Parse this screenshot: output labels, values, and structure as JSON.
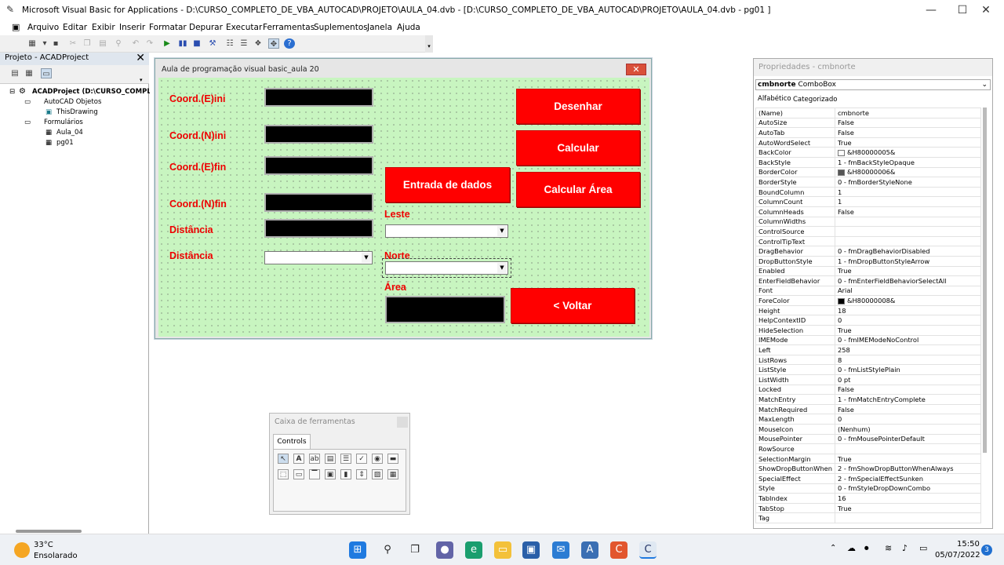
{
  "window": {
    "title": "Microsoft Visual Basic for Applications - D:\\CURSO_COMPLETO_DE_VBA_AUTOCAD\\PROJETO\\AULA_04.dvb - [D:\\CURSO_COMPLETO_DE_VBA_AUTOCAD\\PROJETO\\AULA_04.dvb - pg01 ]",
    "minimize": "—",
    "maximize": "☐",
    "close": "✕"
  },
  "menu": [
    "Arquivo",
    "Editar",
    "Exibir",
    "Inserir",
    "Formatar",
    "Depurar",
    "Executar",
    "Ferramentas",
    "Suplementos",
    "Janela",
    "Ajuda"
  ],
  "project": {
    "header": "Projeto - ACADProject",
    "close": "✕",
    "tree": {
      "root": "ACADProject (D:\\CURSO_COMPLE",
      "autocad_objects": "AutoCAD Objetos",
      "this_drawing": "ThisDrawing",
      "forms": "Formulários",
      "aula04": "Aula_04",
      "pg01": "pg01"
    }
  },
  "form": {
    "title": "Aula de programação visual basic_aula 20",
    "close": "✕",
    "labels": {
      "e_ini": "Coord.(E)ini",
      "n_ini": "Coord.(N)ini",
      "e_fin": "Coord.(E)fin",
      "n_fin": "Coord.(N)fin",
      "dist1": "Distância",
      "dist2": "Distância",
      "leste": "Leste",
      "norte": "Norte",
      "area": "Área"
    },
    "buttons": {
      "desenhar": "Desenhar",
      "calcular": "Calcular",
      "entrada": "Entrada de dados",
      "calc_area": "Calcular Área",
      "voltar": "<  Voltar"
    }
  },
  "properties": {
    "header": "Propriedades - cmbnorte",
    "combo_name": "cmbnorte",
    "combo_type": "ComboBox",
    "tab_alpha": "Alfabético",
    "tab_cat": "Categorizado",
    "rows": [
      [
        "(Name)",
        "cmbnorte"
      ],
      [
        "AutoSize",
        "False"
      ],
      [
        "AutoTab",
        "False"
      ],
      [
        "AutoWordSelect",
        "True"
      ],
      [
        "BackColor",
        "&H80000005&"
      ],
      [
        "BackStyle",
        "1 - fmBackStyleOpaque"
      ],
      [
        "BorderColor",
        "&H80000006&"
      ],
      [
        "BorderStyle",
        "0 - fmBorderStyleNone"
      ],
      [
        "BoundColumn",
        "1"
      ],
      [
        "ColumnCount",
        "1"
      ],
      [
        "ColumnHeads",
        "False"
      ],
      [
        "ColumnWidths",
        ""
      ],
      [
        "ControlSource",
        ""
      ],
      [
        "ControlTipText",
        ""
      ],
      [
        "DragBehavior",
        "0 - fmDragBehaviorDisabled"
      ],
      [
        "DropButtonStyle",
        "1 - fmDropButtonStyleArrow"
      ],
      [
        "Enabled",
        "True"
      ],
      [
        "EnterFieldBehavior",
        "0 - fmEnterFieldBehaviorSelectAll"
      ],
      [
        "Font",
        "Arial"
      ],
      [
        "ForeColor",
        "&H80000008&"
      ],
      [
        "Height",
        "18"
      ],
      [
        "HelpContextID",
        "0"
      ],
      [
        "HideSelection",
        "True"
      ],
      [
        "IMEMode",
        "0 - fmIMEModeNoControl"
      ],
      [
        "Left",
        "258"
      ],
      [
        "ListRows",
        "8"
      ],
      [
        "ListStyle",
        "0 - fmListStylePlain"
      ],
      [
        "ListWidth",
        "0 pt"
      ],
      [
        "Locked",
        "False"
      ],
      [
        "MatchEntry",
        "1 - fmMatchEntryComplete"
      ],
      [
        "MatchRequired",
        "False"
      ],
      [
        "MaxLength",
        "0"
      ],
      [
        "MouseIcon",
        "(Nenhum)"
      ],
      [
        "MousePointer",
        "0 - fmMousePointerDefault"
      ],
      [
        "RowSource",
        ""
      ],
      [
        "SelectionMargin",
        "True"
      ],
      [
        "ShowDropButtonWhen",
        "2 - fmShowDropButtonWhenAlways"
      ],
      [
        "SpecialEffect",
        "2 - fmSpecialEffectSunken"
      ],
      [
        "Style",
        "0 - fmStyleDropDownCombo"
      ],
      [
        "TabIndex",
        "16"
      ],
      [
        "TabStop",
        "True"
      ],
      [
        "Tag",
        ""
      ]
    ],
    "swatches": {
      "BackColor": "#ffffff",
      "BorderColor": "#555555",
      "ForeColor": "#000000"
    }
  },
  "toolbox": {
    "header": "Caixa de ferramentas",
    "tab": "Controls"
  },
  "taskbar": {
    "temp": "33°C",
    "weather": "Ensolarado",
    "time": "15:50",
    "date": "05/07/2022",
    "notif": "3"
  },
  "colors": {
    "form_bg": "#c8f5c0",
    "button_red": "#ff0000",
    "label_red": "#ee0000"
  }
}
